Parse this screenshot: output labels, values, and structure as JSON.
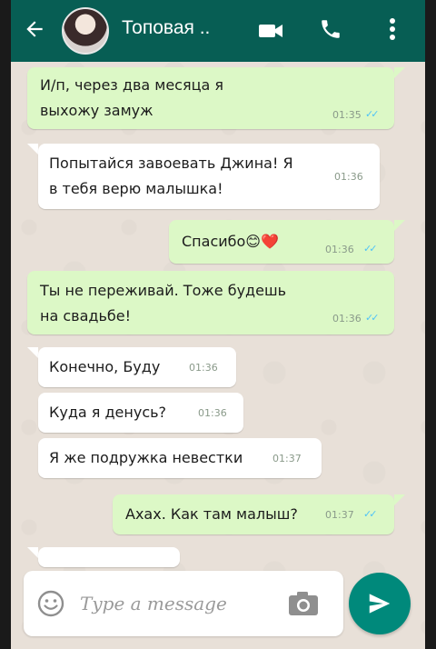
{
  "header": {
    "contact_name": "Топовая ..",
    "accent": "#075e54"
  },
  "messages": [
    {
      "direction": "out",
      "text": "И/п, через два месяца я\nвыхожу замуж",
      "time": "01:35",
      "ticks": "✓✓"
    },
    {
      "direction": "in",
      "text": "Попытайся завоевать Джина! Я\nв тебя верю малышка!",
      "time": "01:36"
    },
    {
      "direction": "out",
      "text": "Спасибо😊❤️",
      "time": "01:36",
      "ticks": "✓✓"
    },
    {
      "direction": "out",
      "text": "Ты не переживай. Тоже будешь\nна свадьбе!",
      "time": "01:36",
      "ticks": "✓✓"
    },
    {
      "direction": "in",
      "text": "Конечно, Буду",
      "time": "01:36"
    },
    {
      "direction": "in",
      "text": "Куда я денусь?",
      "time": "01:36"
    },
    {
      "direction": "in",
      "text": "Я же подружка невестки",
      "time": "01:37"
    },
    {
      "direction": "out",
      "text": "Ахах. Как там малыш?",
      "time": "01:37",
      "ticks": "✓✓"
    }
  ],
  "composer": {
    "placeholder": "Type a message"
  },
  "colors": {
    "incoming_bubble": "#ffffff",
    "outgoing_bubble": "#dcf8c6",
    "send_button": "#00897b",
    "read_ticks": "#4fc3f7"
  }
}
